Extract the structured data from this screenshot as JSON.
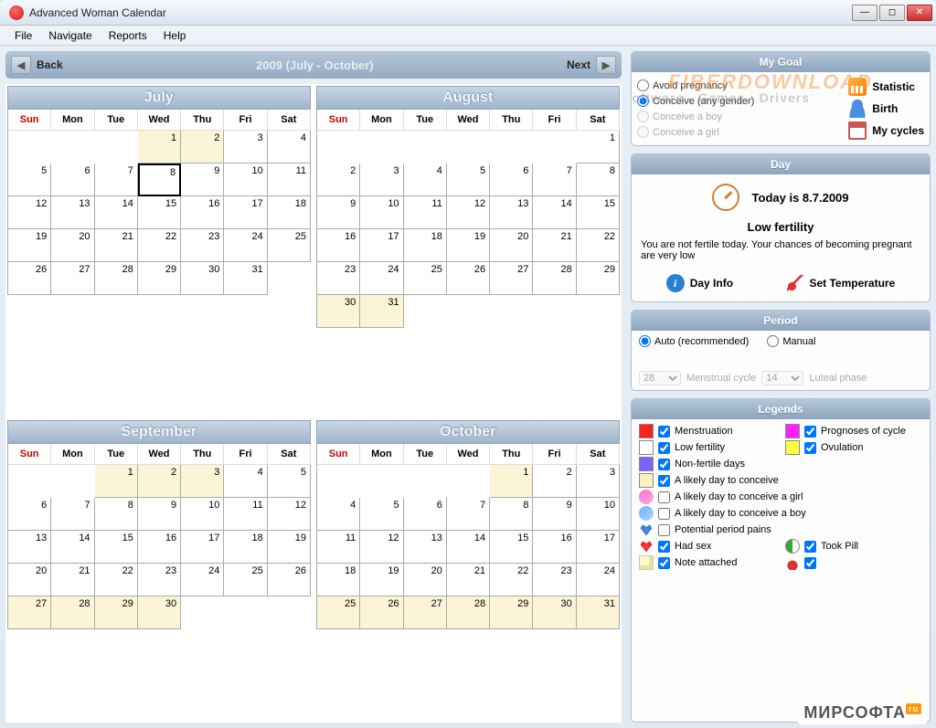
{
  "app": {
    "title": "Advanced Woman Calendar"
  },
  "menubar": [
    "File",
    "Navigate",
    "Reports",
    "Help"
  ],
  "nav": {
    "back": "Back",
    "range": "2009 (July - October)",
    "next": "Next"
  },
  "dayheaders": [
    "Sun",
    "Mon",
    "Tue",
    "Wed",
    "Thu",
    "Fri",
    "Sat"
  ],
  "months": [
    {
      "name": "July",
      "offset": 3,
      "days": 31,
      "today": 8,
      "yl_first": 2,
      "yl_last": false
    },
    {
      "name": "August",
      "offset": 6,
      "days": 31,
      "yl_first": 0,
      "yl_last": true
    },
    {
      "name": "September",
      "offset": 2,
      "days": 30,
      "yl_first": 3,
      "yl_last": true
    },
    {
      "name": "October",
      "offset": 4,
      "days": 31,
      "yl_first": 1,
      "yl_last": true
    }
  ],
  "goal": {
    "title": "My Goal",
    "options": [
      {
        "label": "Avoid pregnancy",
        "checked": false,
        "disabled": false
      },
      {
        "label": "Conceive (any gender)",
        "checked": true,
        "disabled": false
      },
      {
        "label": "Conceive a boy",
        "checked": false,
        "disabled": true
      },
      {
        "label": "Conceive a girl",
        "checked": false,
        "disabled": true
      }
    ],
    "links": [
      {
        "label": "Statistic",
        "icon": "chart"
      },
      {
        "label": "Birth",
        "icon": "person"
      },
      {
        "label": "My cycles",
        "icon": "cal"
      }
    ],
    "watermark1": "FIBERDOWNLOAD",
    "watermark2": "Software - Games - Drivers"
  },
  "day": {
    "title": "Day",
    "today": "Today is 8.7.2009",
    "fertility": "Low fertility",
    "desc": "You are not fertile today. Your chances of becoming pregnant are very low",
    "info": "Day Info",
    "temp": "Set Temperature"
  },
  "period": {
    "title": "Period",
    "auto": "Auto (recommended)",
    "manual": "Manual",
    "cycle_val": "28",
    "cycle_lbl": "Menstrual cycle",
    "luteal_val": "14",
    "luteal_lbl": "Luteal phase"
  },
  "legends": {
    "title": "Legends",
    "items": [
      {
        "swatch": "#ff2020",
        "label": "Menstruation",
        "checked": true,
        "col": 1
      },
      {
        "swatch": "#ff20ff",
        "label": "Prognoses of cycle",
        "checked": true,
        "col": 2
      },
      {
        "swatch": "#ffffff",
        "label": "Low fertility",
        "checked": true,
        "col": 1
      },
      {
        "swatch": "#ffff40",
        "label": "Ovulation",
        "checked": true,
        "col": 2
      },
      {
        "swatch": "#8060ff",
        "label": "Non-fertile days",
        "checked": true,
        "full": true
      },
      {
        "swatch": "#fcf0c0",
        "label": "A likely day to conceive",
        "checked": true,
        "full": true
      },
      {
        "icon": "girl",
        "label": "A likely day to conceive a girl",
        "checked": false,
        "full": true
      },
      {
        "icon": "boy",
        "label": "A likely day to conceive a boy",
        "checked": false,
        "full": true
      },
      {
        "icon": "heart-blue",
        "label": "Potential period pains",
        "checked": false,
        "full": true
      },
      {
        "icon": "heart",
        "label": "Had sex",
        "checked": true,
        "col": 1
      },
      {
        "icon": "pill",
        "label": "Took Pill",
        "checked": true,
        "col": 2
      },
      {
        "icon": "note",
        "label": "Note attached",
        "checked": true,
        "col": 1
      },
      {
        "icon": "drop",
        "label": "",
        "checked": true,
        "col": 2
      }
    ]
  },
  "footer": "МИРСОФТА"
}
